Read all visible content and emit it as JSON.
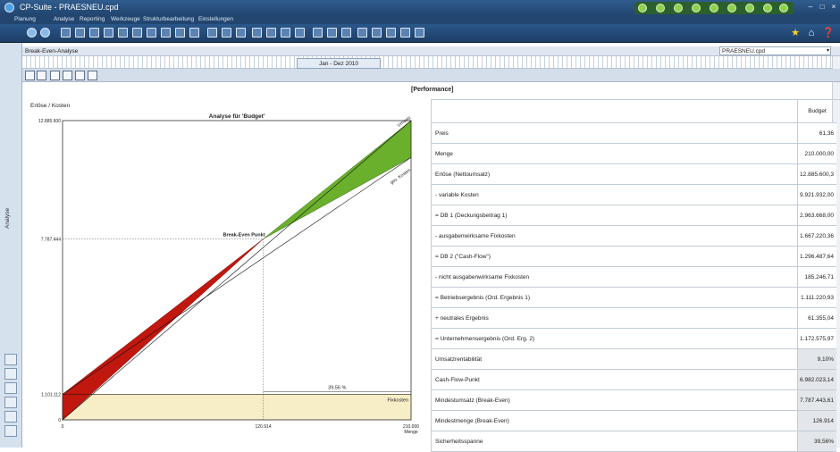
{
  "window": {
    "title": "CP-Suite - PRAESNEU.cpd"
  },
  "menu": [
    "Planung",
    "Analyse",
    "Reporting",
    "Werkzeuge",
    "Strukturbearbeitung",
    "Einstellungen"
  ],
  "sidebar": {
    "label": "Analyse"
  },
  "tab": {
    "title": "Break-Even-Analyse",
    "file_select": "PRAESNEU.cpd"
  },
  "period": {
    "label": "Jan - Dez 2010"
  },
  "panel": {
    "title": "[Performance]"
  },
  "chart_data": {
    "type": "line",
    "title": "Analyse für 'Budget'",
    "ylabel": "Erlöse / Kosten",
    "xlabel": "Menge",
    "x_ticks": [
      "0",
      "120.914",
      "210.000"
    ],
    "y_ticks": [
      "0",
      "1.101.112",
      "7.787.444",
      "12.885.600"
    ],
    "xlim": [
      0,
      210000
    ],
    "ylim": [
      0,
      12885600
    ],
    "series": [
      {
        "name": "Umsatz",
        "x": [
          0,
          210000
        ],
        "y": [
          0,
          12885600
        ]
      },
      {
        "name": "ges. Kosten",
        "x": [
          0,
          210000
        ],
        "y": [
          1101112,
          11300000
        ]
      },
      {
        "name": "Fixkosten",
        "x": [
          0,
          210000
        ],
        "y": [
          1101112,
          1101112
        ]
      }
    ],
    "annotations": [
      "Break-Even Punkt",
      "39,56 %"
    ],
    "break_even": {
      "x": 120914,
      "y": 7787444
    },
    "colors": {
      "loss": "#c0170f",
      "profit": "#6ab02c",
      "fixed": "#f7edc6"
    }
  },
  "table": {
    "header": "Budget",
    "rows": [
      {
        "label": "Preis",
        "value": "61,36"
      },
      {
        "label": "Menge",
        "value": "210.000,00"
      },
      {
        "label": "Erlöse (Nettoumsatz)",
        "value": "12.885.600,3"
      },
      {
        "label": "- variable Kosten",
        "value": "9.921.932,00"
      },
      {
        "label": "= DB 1 (Deckungsbeitrag 1)",
        "value": "2.963.668,00"
      },
      {
        "label": "- ausgabenwirksame Fixkosten",
        "value": "1.667.220,36"
      },
      {
        "label": "= DB 2 (\"Cash-Flow\")",
        "value": "1.296.487,64"
      },
      {
        "label": "- nicht ausgabenwirksame Fixkosten",
        "value": "185.246,71"
      },
      {
        "label": "= Betriebsergebnis (Ord. Ergebnis 1)",
        "value": "1.111.220,93"
      },
      {
        "label": "+ neutrales Ergebnis",
        "value": "61.355,04"
      },
      {
        "label": "= Unternehmensergebnis (Ord. Erg. 2)",
        "value": "1.172.575,97"
      },
      {
        "label": "Umsatzrentabilität",
        "value": "9,10%"
      },
      {
        "label": "Cash-Flow-Punkt",
        "value": "6.982.023,14"
      },
      {
        "label": "Mindestumsatz (Break-Even)",
        "value": "7.787.443,61"
      },
      {
        "label": "Mindestmenge (Break-Even)",
        "value": "126.914"
      },
      {
        "label": "Sicherheitsspanne",
        "value": "39,56%"
      }
    ]
  }
}
